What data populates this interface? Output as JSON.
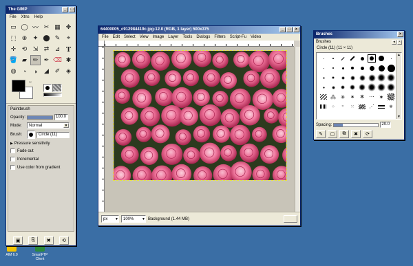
{
  "desktop": {
    "icons": [
      {
        "label": "AIM 6.0",
        "color": "#f2c200"
      },
      {
        "label": "SmartFTP Client",
        "color": "#2c8a3c"
      }
    ]
  },
  "toolbox": {
    "title": "The GIMP",
    "menu": [
      "File",
      "Xtns",
      "Help"
    ],
    "tools": [
      "▭",
      "◯",
      "〰",
      "✂",
      "▦",
      "✥",
      "⬚",
      "⊕",
      "✦",
      "⬤",
      "✎",
      "⌖",
      "✛",
      "⟲",
      "⇲",
      "⇄",
      "⊿",
      "T",
      "🪣",
      "▰",
      "✏",
      "✒",
      "⌫",
      "✱",
      "◍",
      "◔",
      "◑",
      "◢",
      "✐",
      "◈"
    ],
    "fg_color": "#000000",
    "bg_color": "#ffffff",
    "panel_title": "Paintbrush",
    "opacity_label": "Opacity:",
    "opacity_value": "100.0",
    "opacity_level": 1.0,
    "mode_label": "Mode:",
    "mode_value": "Normal",
    "brush_label": "Brush:",
    "brush_value": "Circle (11)",
    "pressure_label": "Pressure sensitivity",
    "fade_label": "Fade out",
    "incremental_label": "Incremental",
    "gradient_label": "Use color from gradient"
  },
  "image_window": {
    "title": "64400005_c912984419c.jpg-12.0 (RGB, 1 layer) 500x375",
    "menu": [
      "File",
      "Edit",
      "Select",
      "View",
      "Image",
      "Layer",
      "Tools",
      "Dialogs",
      "Filters",
      "Script-Fu",
      "Video"
    ],
    "unit_value": "px",
    "zoom_value": "100%",
    "status_text": "Background (1.44 MB)"
  },
  "brushes": {
    "title": "Brushes",
    "panel_title": "Brushes",
    "brush_name": "Circle (11) (11 × 11)",
    "spacing_label": "Spacing:",
    "spacing_value": "20.0",
    "spacing_level": 0.2
  }
}
